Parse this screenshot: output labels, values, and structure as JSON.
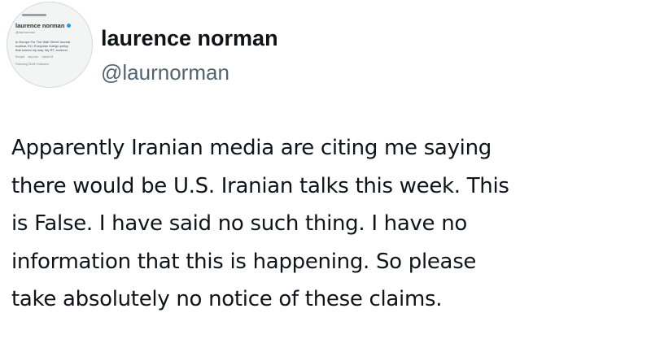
{
  "author": {
    "display_name": "laurence norman",
    "handle": "@laurnorman"
  },
  "avatar": {
    "icon": "profile-screenshot-avatar",
    "name": "laurence norman",
    "handle": "@laurnorman",
    "bio_lines": [
      "In Europe For The Wall Street Journal.",
      "nuclear, EU, European foreign policy",
      "that comes my way. My RT, someon"
    ],
    "meta": [
      "Europe",
      "wsj.com",
      "Joined M"
    ],
    "stats": "Following  28.6K Followers"
  },
  "tweet": {
    "lines": [
      "Apparently Iranian media are citing me saying",
      "there would be U.S. Iranian talks this week. This",
      "is False. I have said no such thing. I have no",
      "information that this is happening. So please",
      "take absolutely no notice of these claims."
    ]
  },
  "colors": {
    "text_primary": "#0f1419",
    "text_secondary": "#536471",
    "verified": "#1d9bf0"
  }
}
